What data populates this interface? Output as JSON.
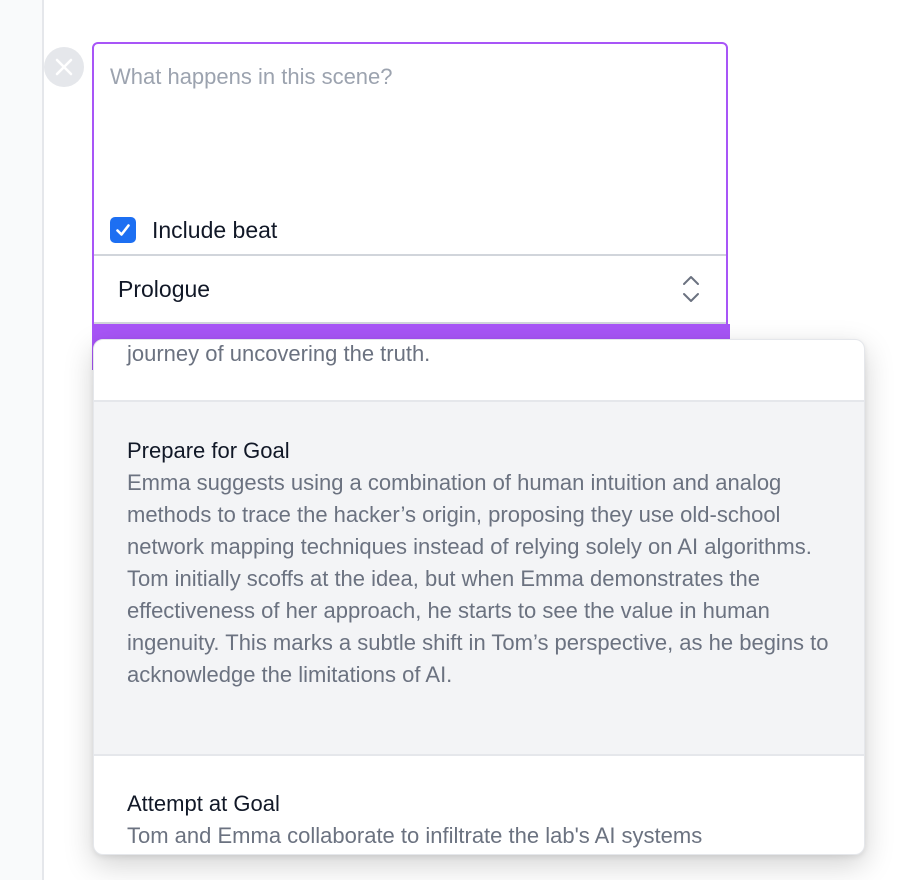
{
  "scene": {
    "placeholder": "What happens in this scene?",
    "include_beat_label": "Include beat",
    "include_beat_checked": true,
    "beat_selected": "Prologue"
  },
  "dropdown": {
    "options": [
      {
        "title": "",
        "description": "journey of uncovering the truth."
      },
      {
        "title": "Prepare for Goal",
        "description": "Emma suggests using a combination of human intuition and analog methods to trace the hacker’s origin, proposing they use old-school network mapping techniques instead of relying solely on AI algorithms. Tom initially scoffs at the idea, but when Emma demonstrates the effectiveness of her approach, he starts to see the value in human ingenuity. This marks a subtle shift in Tom’s perspective, as he begins to acknowledge the limitations of AI."
      },
      {
        "title": "Attempt at Goal",
        "description": "Tom and Emma collaborate to infiltrate the lab's AI systems"
      }
    ]
  },
  "colors": {
    "accent": "#a855f7",
    "checkbox": "#1d6ff2",
    "highlight_bg": "#f3f4f6"
  },
  "icons": {
    "remove": "close-circle-icon",
    "checkbox": "checkmark-icon",
    "select": "chevron-up-down-icon"
  }
}
